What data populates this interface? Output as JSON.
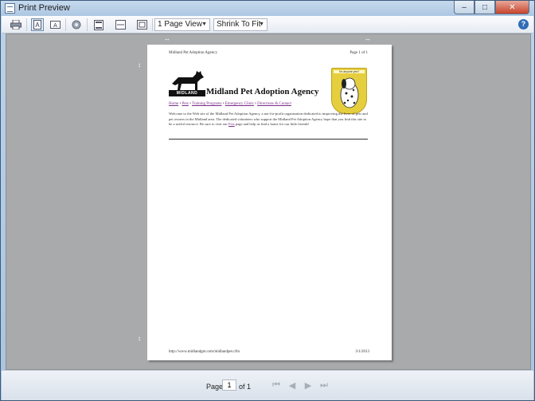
{
  "window": {
    "title": "Print Preview"
  },
  "titlebar_buttons": {
    "minimize": "–",
    "maximize": "□",
    "close": "✕"
  },
  "toolbar": {
    "page_view": "1 Page View",
    "shrink": "Shrink To Fit",
    "help": "?"
  },
  "page": {
    "header_left": "Midland Pet Adoption Agency",
    "header_right": "Page 1 of 1",
    "logo_label": "MIDLAND",
    "agency_title": "Midland Pet Adoption Agency",
    "dog_caption": "I'm anyone yes?",
    "nav": [
      "Home",
      "Pets",
      "Training Programs",
      "Emergency Clinic",
      "Directions & Contact"
    ],
    "nav_sep": " • ",
    "body_before": "Welcome to the Web site of the Midland Pet Adoption Agency, a not-for-profit organization dedicated to improving the lives of pets and pet owners in the Midland area. The dedicated volunteers who support the Midland Pet Adoption Agency hope that you find this site to be a useful resource. Be sure to visit our ",
    "body_link": "Pets",
    "body_after": " page and help us find a home for our little friends!",
    "footer_left": "http://www.midlandget.com/midlandpet.cfm",
    "footer_right": "3/1/2013"
  },
  "statusbar": {
    "page_label": "Page",
    "page_value": "1",
    "of_label": "of 1"
  },
  "icons": [
    "print-icon",
    "portrait-icon",
    "landscape-icon",
    "page-setup-icon",
    "header-footer-icon",
    "full-width-icon",
    "full-page-icon",
    "help-icon",
    "first-page-icon",
    "prev-page-icon",
    "next-page-icon",
    "last-page-icon"
  ]
}
